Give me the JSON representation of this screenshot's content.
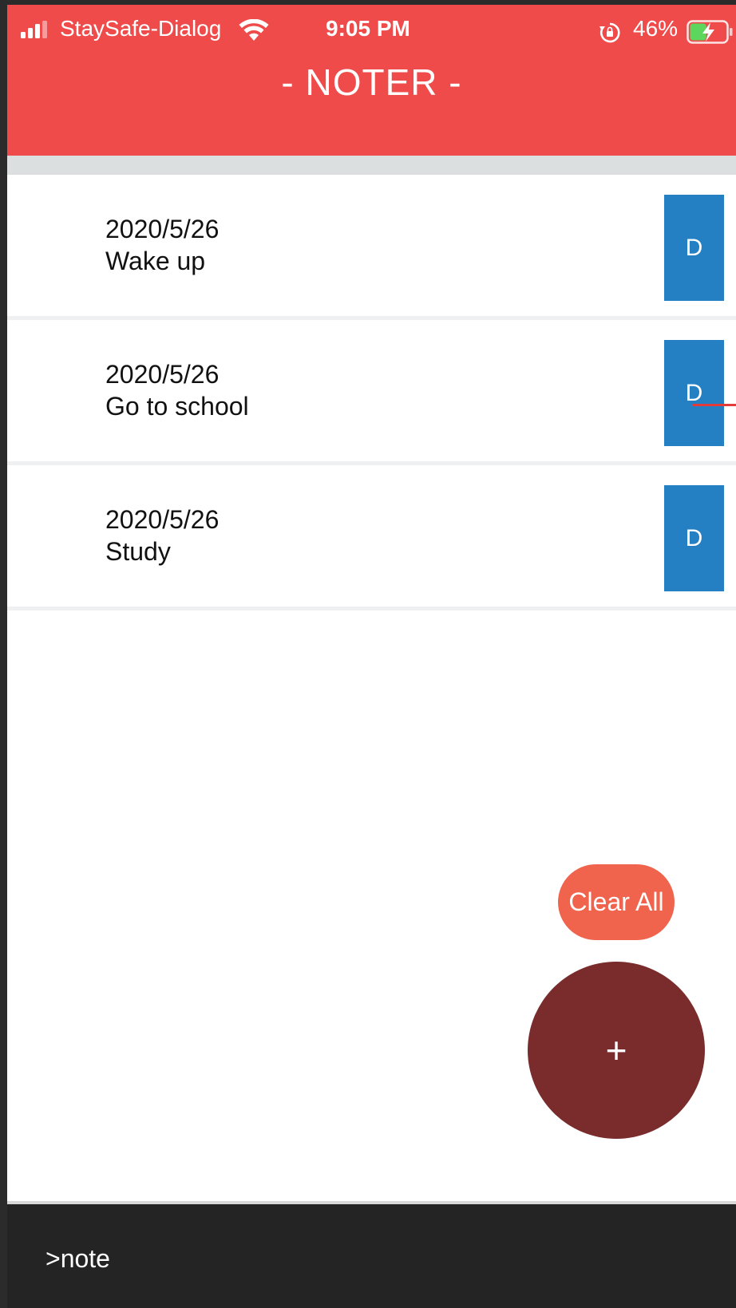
{
  "status_bar": {
    "carrier": "StaySafe-Dialog",
    "time": "9:05 PM",
    "battery_percent": "46%",
    "battery_level": 0.46,
    "icons": [
      "signal-icon",
      "wifi-icon",
      "rotation-lock-icon",
      "battery-charging-icon"
    ]
  },
  "header": {
    "title": "- NOTER -"
  },
  "notes": [
    {
      "date": "2020/5/26",
      "title": "Wake up",
      "delete_label": "D"
    },
    {
      "date": "2020/5/26",
      "title": "Go to school",
      "delete_label": "D"
    },
    {
      "date": "2020/5/26",
      "title": "Study",
      "delete_label": "D"
    }
  ],
  "actions": {
    "clear_all_label": "Clear All",
    "add_label": "+"
  },
  "footer": {
    "command_text": ">note"
  },
  "colors": {
    "header": "#ef4b4b",
    "delete_button": "#2480c3",
    "clear_all": "#f0634d",
    "add_button": "#7a2c2d",
    "footer": "#242424"
  }
}
